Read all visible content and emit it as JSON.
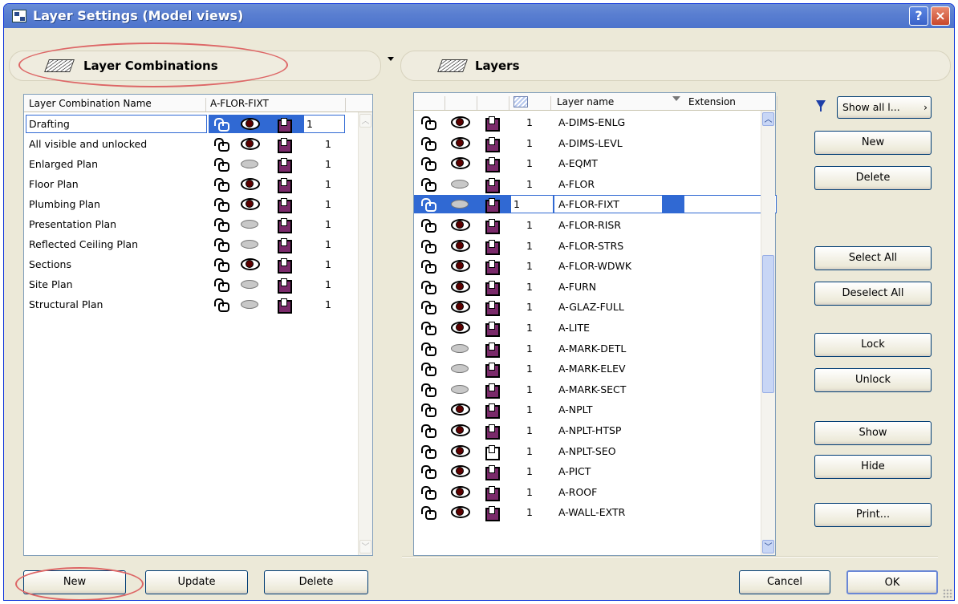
{
  "window": {
    "title": "Layer Settings (Model views)",
    "help_label": "?",
    "close_label": "×"
  },
  "left": {
    "header": "Layer Combinations",
    "columns": {
      "name": "Layer Combination Name",
      "layer": "A-FLOR-FIXT"
    },
    "combinations": [
      {
        "name": "Drafting",
        "eye": "visible",
        "num": "1",
        "selected": true
      },
      {
        "name": "All visible and unlocked",
        "eye": "visible",
        "num": "1"
      },
      {
        "name": "Enlarged Plan",
        "eye": "hidden",
        "num": "1"
      },
      {
        "name": "Floor Plan",
        "eye": "visible",
        "num": "1"
      },
      {
        "name": "Plumbing Plan",
        "eye": "visible",
        "num": "1"
      },
      {
        "name": "Presentation Plan",
        "eye": "hidden",
        "num": "1"
      },
      {
        "name": "Reflected Ceiling Plan",
        "eye": "hidden",
        "num": "1"
      },
      {
        "name": "Sections",
        "eye": "visible",
        "num": "1"
      },
      {
        "name": "Site Plan",
        "eye": "hidden",
        "num": "1"
      },
      {
        "name": "Structural Plan",
        "eye": "hidden",
        "num": "1"
      }
    ],
    "buttons": {
      "new": "New",
      "update": "Update",
      "delete": "Delete"
    }
  },
  "right": {
    "header": "Layers",
    "columns": {
      "name": "Layer name",
      "extension": "Extension"
    },
    "layers": [
      {
        "num": "1",
        "name": "A-DIMS-ENLG",
        "eye": "visible",
        "wire": "solid"
      },
      {
        "num": "1",
        "name": "A-DIMS-LEVL",
        "eye": "visible",
        "wire": "solid"
      },
      {
        "num": "1",
        "name": "A-EQMT",
        "eye": "visible",
        "wire": "solid"
      },
      {
        "num": "1",
        "name": "A-FLOR",
        "eye": "hidden",
        "wire": "solid"
      },
      {
        "num": "1",
        "name": "A-FLOR-FIXT",
        "eye": "hidden",
        "wire": "solid",
        "selected": true
      },
      {
        "num": "1",
        "name": "A-FLOR-RISR",
        "eye": "visible",
        "wire": "solid"
      },
      {
        "num": "1",
        "name": "A-FLOR-STRS",
        "eye": "visible",
        "wire": "solid"
      },
      {
        "num": "1",
        "name": "A-FLOR-WDWK",
        "eye": "visible",
        "wire": "solid"
      },
      {
        "num": "1",
        "name": "A-FURN",
        "eye": "visible",
        "wire": "solid"
      },
      {
        "num": "1",
        "name": "A-GLAZ-FULL",
        "eye": "visible",
        "wire": "solid"
      },
      {
        "num": "1",
        "name": "A-LITE",
        "eye": "visible",
        "wire": "solid"
      },
      {
        "num": "1",
        "name": "A-MARK-DETL",
        "eye": "hidden",
        "wire": "solid"
      },
      {
        "num": "1",
        "name": "A-MARK-ELEV",
        "eye": "hidden",
        "wire": "solid"
      },
      {
        "num": "1",
        "name": "A-MARK-SECT",
        "eye": "hidden",
        "wire": "solid"
      },
      {
        "num": "1",
        "name": "A-NPLT",
        "eye": "visible",
        "wire": "solid"
      },
      {
        "num": "1",
        "name": "A-NPLT-HTSP",
        "eye": "visible",
        "wire": "solid"
      },
      {
        "num": "1",
        "name": "A-NPLT-SEO",
        "eye": "visible",
        "wire": "outline"
      },
      {
        "num": "1",
        "name": "A-PICT",
        "eye": "visible",
        "wire": "solid"
      },
      {
        "num": "1",
        "name": "A-ROOF",
        "eye": "visible",
        "wire": "solid"
      },
      {
        "num": "1",
        "name": "A-WALL-EXTR",
        "eye": "visible",
        "wire": "solid"
      }
    ],
    "filter_label": "Show all l...",
    "buttons": {
      "new": "New",
      "delete": "Delete",
      "select_all": "Select All",
      "deselect_all": "Deselect All",
      "lock": "Lock",
      "unlock": "Unlock",
      "show": "Show",
      "hide": "Hide",
      "print": "Print...",
      "cancel": "Cancel",
      "ok": "OK"
    }
  },
  "colors": {
    "selection": "#3069d3",
    "annotation": "#d66666"
  }
}
